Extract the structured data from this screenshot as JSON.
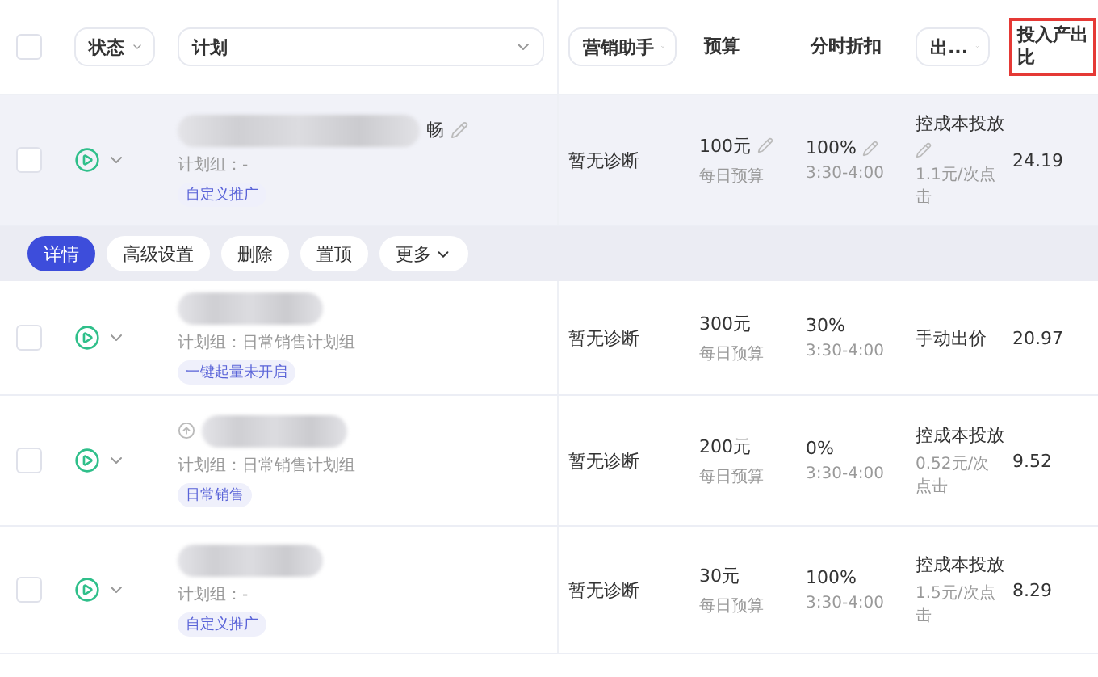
{
  "header": {
    "checkbox": {
      "checked": false
    },
    "columns": [
      {
        "label": "状态",
        "kind": "dropdown",
        "highlighted": false
      },
      {
        "label": "计划",
        "kind": "dropdown",
        "highlighted": false
      },
      {
        "label": "营销助手",
        "kind": "dropdown",
        "highlighted": false
      },
      {
        "label": "预算",
        "kind": "plain",
        "highlighted": false
      },
      {
        "label": "分时折扣",
        "kind": "plain",
        "highlighted": false
      },
      {
        "label": "出...",
        "kind": "dropdown",
        "highlighted": false
      },
      {
        "label": "投入产出比",
        "kind": "plain",
        "highlighted": true
      }
    ]
  },
  "rows": [
    {
      "checked": false,
      "name_tail": "畅",
      "name_editable": true,
      "pinned_icon": false,
      "group": "计划组：-",
      "tag": "自定义推广",
      "diagnosis": "暂无诊断",
      "budget": "100元",
      "budget_note": "每日预算",
      "discount": "100%",
      "discount_time": "3:30-4:00",
      "bid_mode": "控成本投放",
      "bid": "1.1元/次点击",
      "roi": "24.19",
      "editable": true,
      "hovered": true
    },
    {
      "checked": false,
      "name_tail": "",
      "name_editable": false,
      "pinned_icon": false,
      "group": "计划组：日常销售计划组",
      "tag": "一键起量未开启",
      "diagnosis": "暂无诊断",
      "budget": "300元",
      "budget_note": "每日预算",
      "discount": "30%",
      "discount_time": "3:30-4:00",
      "bid_mode": "手动出价",
      "bid": "",
      "roi": "20.97",
      "editable": false,
      "hovered": false
    },
    {
      "checked": false,
      "name_tail": "",
      "name_editable": false,
      "pinned_icon": true,
      "group": "计划组：日常销售计划组",
      "tag": "日常销售",
      "diagnosis": "暂无诊断",
      "budget": "200元",
      "budget_note": "每日预算",
      "discount": "0%",
      "discount_time": "3:30-4:00",
      "bid_mode": "控成本投放",
      "bid": "0.52元/次点击",
      "roi": "9.52",
      "editable": false,
      "hovered": false
    },
    {
      "checked": false,
      "name_tail": "",
      "name_editable": false,
      "pinned_icon": false,
      "group": "计划组：-",
      "tag": "自定义推广",
      "diagnosis": "暂无诊断",
      "budget": "30元",
      "budget_note": "每日预算",
      "discount": "100%",
      "discount_time": "3:30-4:00",
      "bid_mode": "控成本投放",
      "bid": "1.5元/次点击",
      "roi": "8.29",
      "editable": false,
      "hovered": false
    }
  ],
  "action_bar": {
    "buttons": [
      {
        "label": "详情",
        "primary": true,
        "caret": false
      },
      {
        "label": "高级设置",
        "primary": false,
        "caret": false
      },
      {
        "label": "删除",
        "primary": false,
        "caret": false
      },
      {
        "label": "置顶",
        "primary": false,
        "caret": false
      },
      {
        "label": "更多",
        "primary": false,
        "caret": true
      }
    ]
  }
}
